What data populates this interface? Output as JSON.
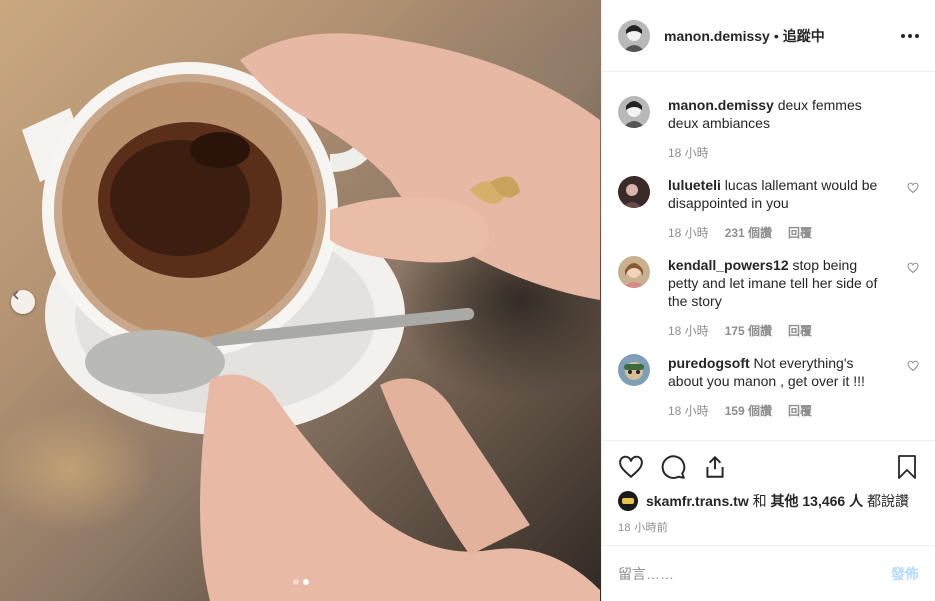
{
  "header": {
    "username": "manon.demissy",
    "separator": "•",
    "follow_label": "追蹤中"
  },
  "caption": {
    "username": "manon.demissy",
    "text": "deux femmes deux ambiances",
    "time": "18 小時"
  },
  "comments": [
    {
      "username": "lulueteli",
      "text": "lucas lallemant would be disappointed in you",
      "time": "18 小時",
      "likes": "231 個讚",
      "reply": "回覆"
    },
    {
      "username": "kendall_powers12",
      "text": "stop being petty and let imane tell her side of the story",
      "time": "18 小時",
      "likes": "175 個讚",
      "reply": "回覆"
    },
    {
      "username": "puredogsoft",
      "text": "Not everything's about you manon , get over it !!!",
      "time": "18 小時",
      "likes": "159 個讚",
      "reply": "回覆"
    }
  ],
  "likes_line": {
    "user": "skamfr.trans.tw",
    "and": "和",
    "others": "其他 13,466 人",
    "suffix": "都說讚"
  },
  "timestamp": "18 小時前",
  "comment_box": {
    "placeholder": "留言……",
    "post_label": "發佈"
  },
  "carousel": {
    "total": 2,
    "active": 2
  },
  "icons": {
    "more": "more-options-icon",
    "prev": "chevron-left-icon",
    "like": "heart-icon",
    "comment": "comment-icon",
    "share": "share-icon",
    "save": "bookmark-icon"
  },
  "colors": {
    "post_button_disabled": "#b3dbff",
    "text": "#262626",
    "muted": "#8e8e8e",
    "border": "#efefef"
  }
}
